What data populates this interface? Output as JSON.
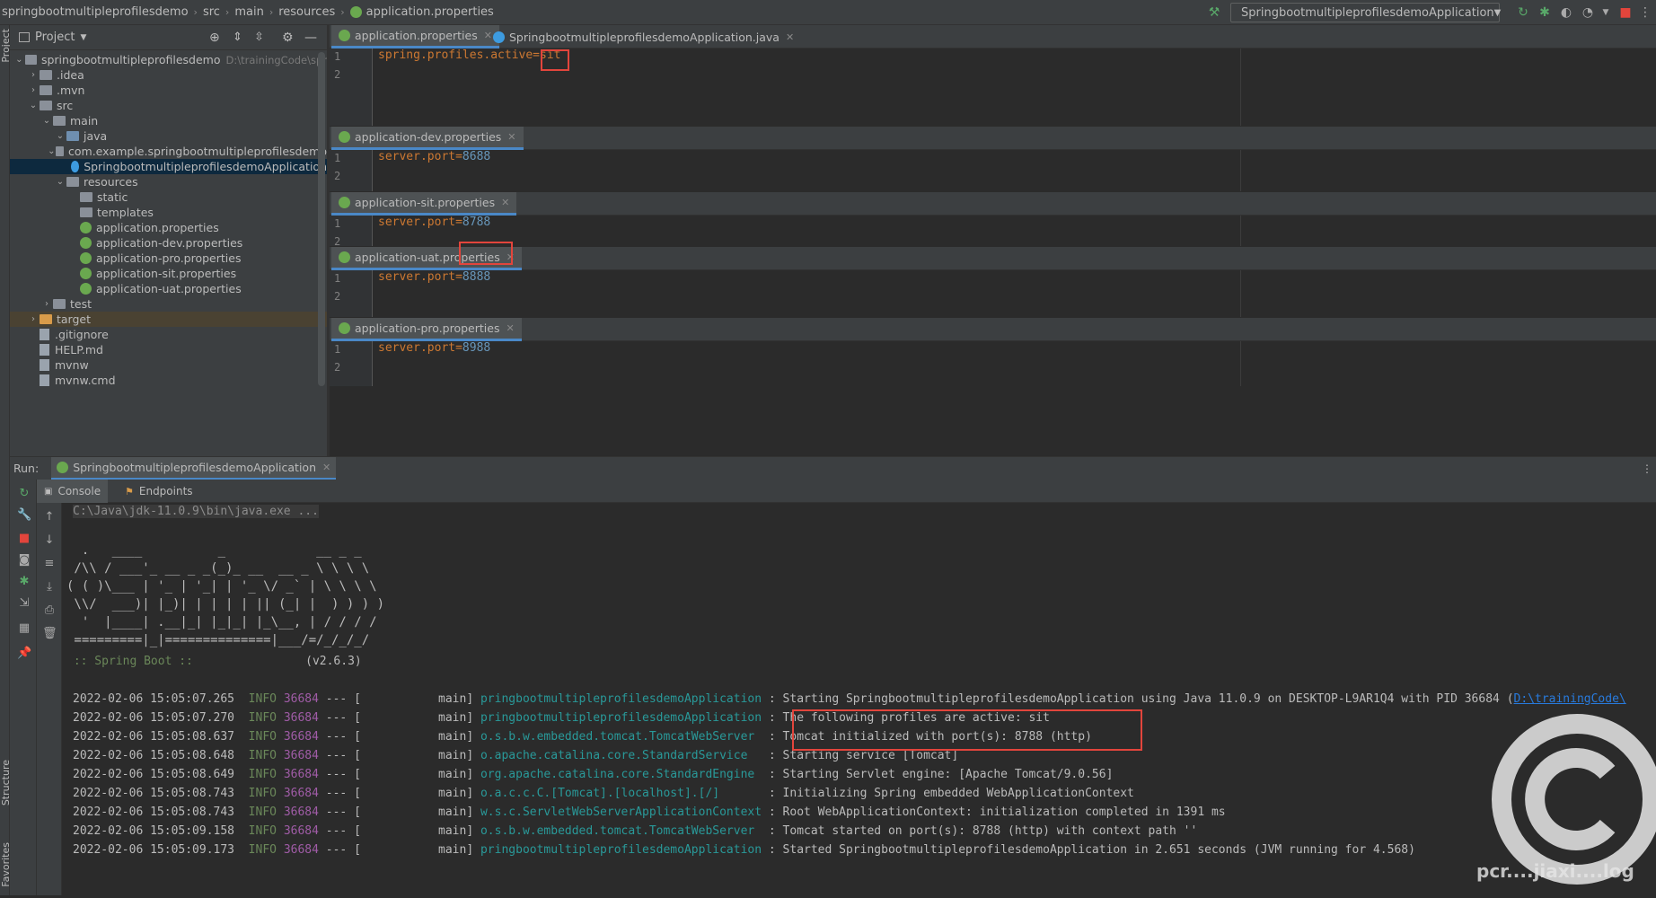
{
  "breadcrumb": [
    "springbootmultipleprofilesdemo",
    "src",
    "main",
    "resources",
    "application.properties"
  ],
  "run_config": {
    "label": "SpringbootmultipleprofilesdemoApplication"
  },
  "project_panel": {
    "title": "Project"
  },
  "side_labels": {
    "project": "Project",
    "structure": "Structure",
    "favorites": "Favorites"
  },
  "tree": [
    {
      "label": "springbootmultipleprofilesdemo",
      "hint": "D:\\trainingCode\\spr",
      "indent": 0,
      "chev": "v",
      "icon": "folder"
    },
    {
      "label": ".idea",
      "indent": 1,
      "chev": ">",
      "icon": "folder"
    },
    {
      "label": ".mvn",
      "indent": 1,
      "chev": ">",
      "icon": "folder"
    },
    {
      "label": "src",
      "indent": 1,
      "chev": "v",
      "icon": "folder"
    },
    {
      "label": "main",
      "indent": 2,
      "chev": "v",
      "icon": "folder"
    },
    {
      "label": "java",
      "indent": 3,
      "chev": "v",
      "icon": "folder-src"
    },
    {
      "label": "com.example.springbootmultipleprofilesdemo",
      "indent": 4,
      "chev": "v",
      "icon": "folder"
    },
    {
      "label": "SpringbootmultipleprofilesdemoApplication",
      "indent": 5,
      "chev": "",
      "icon": "spring-java",
      "selected": true
    },
    {
      "label": "resources",
      "indent": 3,
      "chev": "v",
      "icon": "folder-res"
    },
    {
      "label": "static",
      "indent": 4,
      "chev": "",
      "icon": "folder"
    },
    {
      "label": "templates",
      "indent": 4,
      "chev": "",
      "icon": "folder"
    },
    {
      "label": "application.properties",
      "indent": 4,
      "chev": "",
      "icon": "spring"
    },
    {
      "label": "application-dev.properties",
      "indent": 4,
      "chev": "",
      "icon": "spring"
    },
    {
      "label": "application-pro.properties",
      "indent": 4,
      "chev": "",
      "icon": "spring"
    },
    {
      "label": "application-sit.properties",
      "indent": 4,
      "chev": "",
      "icon": "spring"
    },
    {
      "label": "application-uat.properties",
      "indent": 4,
      "chev": "",
      "icon": "spring"
    },
    {
      "label": "test",
      "indent": 2,
      "chev": ">",
      "icon": "folder"
    },
    {
      "label": "target",
      "indent": 1,
      "chev": ">",
      "icon": "folder-orange",
      "target": true
    },
    {
      "label": ".gitignore",
      "indent": 1,
      "chev": "",
      "icon": "doc"
    },
    {
      "label": "HELP.md",
      "indent": 1,
      "chev": "",
      "icon": "doc"
    },
    {
      "label": "mvnw",
      "indent": 1,
      "chev": "",
      "icon": "doc"
    },
    {
      "label": "mvnw.cmd",
      "indent": 1,
      "chev": "",
      "icon": "doc"
    }
  ],
  "editors": [
    {
      "tabs": [
        {
          "label": "application.properties",
          "active": true
        },
        {
          "label": "SpringbootmultipleprofilesdemoApplication.java",
          "active": false
        }
      ],
      "lines": [
        {
          "n": "1",
          "key": "spring.profiles.active=",
          "val": "sit"
        },
        {
          "n": "2"
        }
      ]
    },
    {
      "tabs": [
        {
          "label": "application-dev.properties",
          "active": true
        }
      ],
      "lines": [
        {
          "n": "1",
          "key": "server.port=",
          "val": "8688"
        },
        {
          "n": "2"
        }
      ]
    },
    {
      "tabs": [
        {
          "label": "application-sit.properties",
          "active": true
        }
      ],
      "lines": [
        {
          "n": "1",
          "key": "server.port=",
          "val": "8788"
        },
        {
          "n": "2"
        }
      ]
    },
    {
      "tabs": [
        {
          "label": "application-uat.properties",
          "active": true
        }
      ],
      "lines": [
        {
          "n": "1",
          "key": "server.port=",
          "val": "8888"
        },
        {
          "n": "2"
        }
      ]
    },
    {
      "tabs": [
        {
          "label": "application-pro.properties",
          "active": true
        }
      ],
      "lines": [
        {
          "n": "1",
          "key": "server.port=",
          "val": "8988"
        },
        {
          "n": "2"
        }
      ]
    }
  ],
  "run": {
    "label": "Run:",
    "tab": "SpringbootmultipleprofilesdemoApplication",
    "subtabs": [
      "Console",
      "Endpoints"
    ]
  },
  "console": {
    "cmd": "C:\\Java\\jdk-11.0.9\\bin\\java.exe ...",
    "banner": [
      "  .   ____          _            __ _ _",
      " /\\\\ / ___'_ __ _ _(_)_ __  __ _ \\ \\ \\ \\",
      "( ( )\\___ | '_ | '_| | '_ \\/ _` | \\ \\ \\ \\",
      " \\\\/  ___)| |_)| | | | | || (_| |  ) ) ) )",
      "  '  |____| .__|_| |_|_| |_\\__, | / / / /",
      " =========|_|==============|___/=/_/_/_/"
    ],
    "boot_label": " :: Spring Boot :: ",
    "boot_version": "               (v2.6.3)",
    "logs": [
      {
        "ts": "2022-02-06 15:05:07.265",
        "level": "INFO",
        "pid": "36684",
        "thread": "--- [           main]",
        "logger": "pringbootmultipleprofilesdemoApplication",
        "msg": " : Starting SpringbootmultipleprofilesdemoApplication using Java 11.0.9 on DESKTOP-L9AR1Q4 with PID 36684 (",
        "link": "D:\\trainingCode\\"
      },
      {
        "ts": "2022-02-06 15:05:07.270",
        "level": "INFO",
        "pid": "36684",
        "thread": "--- [           main]",
        "logger": "pringbootmultipleprofilesdemoApplication",
        "msg": " : The following profiles are active: sit"
      },
      {
        "ts": "2022-02-06 15:05:08.637",
        "level": "INFO",
        "pid": "36684",
        "thread": "--- [           main]",
        "logger": "o.s.b.w.embedded.tomcat.TomcatWebServer ",
        "msg": " : Tomcat initialized with port(s): 8788 (http)"
      },
      {
        "ts": "2022-02-06 15:05:08.648",
        "level": "INFO",
        "pid": "36684",
        "thread": "--- [           main]",
        "logger": "o.apache.catalina.core.StandardService  ",
        "msg": " : Starting service [Tomcat]"
      },
      {
        "ts": "2022-02-06 15:05:08.649",
        "level": "INFO",
        "pid": "36684",
        "thread": "--- [           main]",
        "logger": "org.apache.catalina.core.StandardEngine ",
        "msg": " : Starting Servlet engine: [Apache Tomcat/9.0.56]"
      },
      {
        "ts": "2022-02-06 15:05:08.743",
        "level": "INFO",
        "pid": "36684",
        "thread": "--- [           main]",
        "logger": "o.a.c.c.C.[Tomcat].[localhost].[/]      ",
        "msg": " : Initializing Spring embedded WebApplicationContext"
      },
      {
        "ts": "2022-02-06 15:05:08.743",
        "level": "INFO",
        "pid": "36684",
        "thread": "--- [           main]",
        "logger": "w.s.c.ServletWebServerApplicationContext",
        "msg": " : Root WebApplicationContext: initialization completed in 1391 ms"
      },
      {
        "ts": "2022-02-06 15:05:09.158",
        "level": "INFO",
        "pid": "36684",
        "thread": "--- [           main]",
        "logger": "o.s.b.w.embedded.tomcat.TomcatWebServer ",
        "msg": " : Tomcat started on port(s): 8788 (http) with context path ''"
      },
      {
        "ts": "2022-02-06 15:05:09.173",
        "level": "INFO",
        "pid": "36684",
        "thread": "--- [           main]",
        "logger": "pringbootmultipleprofilesdemoApplication",
        "msg": " : Started SpringbootmultipleprofilesdemoApplication in 2.651 seconds (JVM running for 4.568)"
      }
    ]
  },
  "watermark": {
    "text": "pcr....jiaxi....log"
  },
  "colors": {
    "accent": "#4a88c7",
    "highlight_box": "#e2453c",
    "key": "#cc7832",
    "number": "#6897bb",
    "logger": "#299999"
  }
}
